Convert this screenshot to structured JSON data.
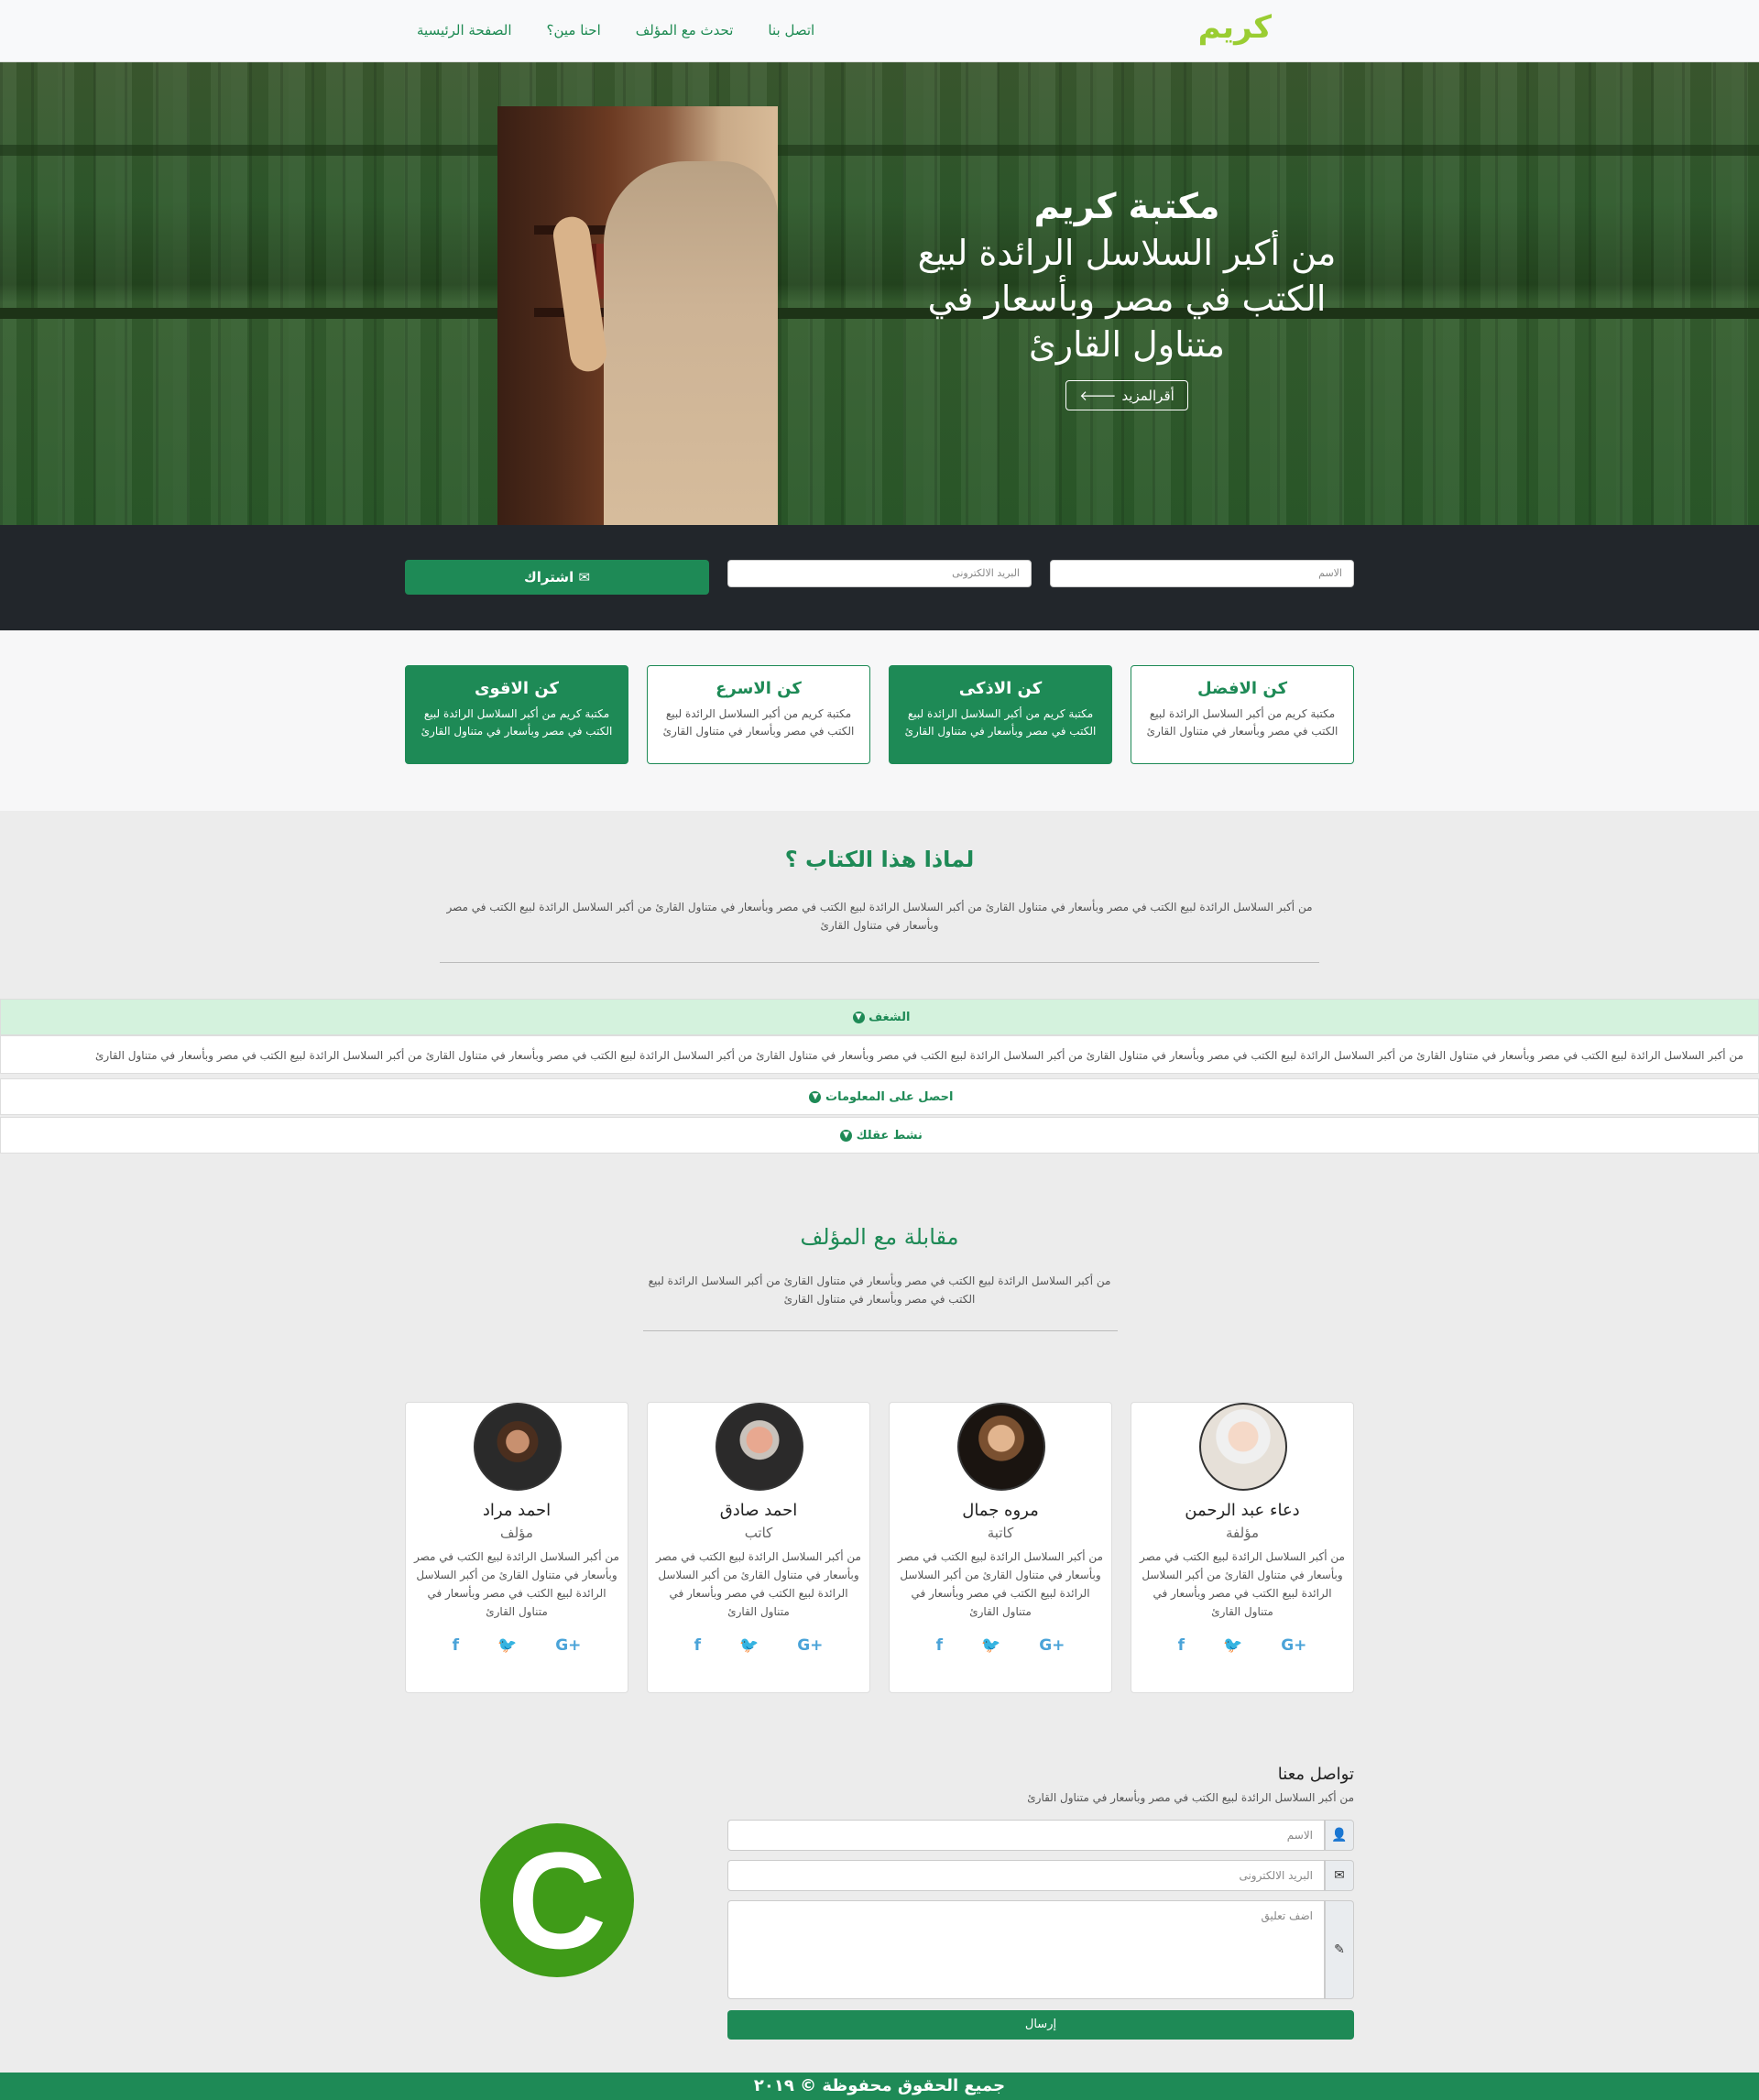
{
  "nav": {
    "brand": "كريم",
    "links": [
      "الصفحة الرئيسية",
      "احنا مين؟",
      "تحدث مع المؤلف",
      "اتصل بنا"
    ]
  },
  "hero": {
    "title": "مكتبة كريم",
    "subtitle": "من أكبر السلاسل الرائدة لبيع الكتب في مصر وبأسعار في متناول القارئ",
    "button_label": "أقرالمزيد",
    "button_icon": "arrow-left-icon"
  },
  "subscribe": {
    "name_placeholder": "الاسم",
    "email_placeholder": "البريد الالكترونى",
    "button_label": "اشتراك",
    "button_icon": "envelope-icon"
  },
  "features": [
    {
      "title": "كن الافضل",
      "text": "مكتبة كريم من أكبر السلاسل الرائدة لبيع الكتب في مصر وبأسعار في متناول القارئ",
      "style": "outline"
    },
    {
      "title": "كن الاذكى",
      "text": "مكتبة كريم من أكبر السلاسل الرائدة لبيع الكتب في مصر وبأسعار في متناول القارئ",
      "style": "filled"
    },
    {
      "title": "كن الاسرع",
      "text": "مكتبة كريم من أكبر السلاسل الرائدة لبيع الكتب في مصر وبأسعار في متناول القارئ",
      "style": "outline"
    },
    {
      "title": "كن الاقوى",
      "text": "مكتبة كريم من أكبر السلاسل الرائدة لبيع الكتب في مصر وبأسعار في متناول القارئ",
      "style": "filled"
    }
  ],
  "why": {
    "title": "لماذا هذا الكتاب ؟",
    "text": "من أكبر السلاسل الرائدة لبيع الكتب في مصر وبأسعار في متناول القارئ من أكبر السلاسل الرائدة لبيع الكتب في مصر وبأسعار في متناول القارئ من أكبر السلاسل الرائدة لبيع الكتب في مصر وبأسعار في متناول القارئ"
  },
  "accordion": {
    "items": [
      "الشغف",
      "احصل على المعلومات",
      "نشط عقلك"
    ],
    "body": "من أكبر السلاسل الرائدة لبيع الكتب في مصر وبأسعار في متناول القارئ من أكبر السلاسل الرائدة لبيع الكتب في مصر وبأسعار في متناول القارئ من أكبر السلاسل الرائدة لبيع الكتب في مصر وبأسعار في متناول القارئ من أكبر السلاسل الرائدة لبيع الكتب في مصر وبأسعار في متناول القارئ من أكبر السلاسل الرائدة لبيع الكتب في مصر وبأسعار في متناول القارئ"
  },
  "interview": {
    "title": "مقابلة مع المؤلف",
    "text": "من أكبر السلاسل الرائدة لبيع الكتب في مصر وبأسعار في متناول القارئ من أكبر السلاسل الرائدة لبيع الكتب في مصر وبأسعار في متناول القارئ"
  },
  "authors": [
    {
      "name": "دعاء عبد الرحمن",
      "role": "مؤلفة",
      "bio": "من أكبر السلاسل الرائدة لبيع الكتب في مصر وبأسعار في متناول القارئ من أكبر السلاسل الرائدة لبيع الكتب في مصر وبأسعار في متناول القارئ"
    },
    {
      "name": "مروه جمال",
      "role": "كاتبة",
      "bio": "من أكبر السلاسل الرائدة لبيع الكتب في مصر وبأسعار في متناول القارئ من أكبر السلاسل الرائدة لبيع الكتب في مصر وبأسعار في متناول القارئ"
    },
    {
      "name": "احمد صادق",
      "role": "كاتب",
      "bio": "من أكبر السلاسل الرائدة لبيع الكتب في مصر وبأسعار في متناول القارئ من أكبر السلاسل الرائدة لبيع الكتب في مصر وبأسعار في متناول القارئ"
    },
    {
      "name": "احمد مراد",
      "role": "مؤلف",
      "bio": "من أكبر السلاسل الرائدة لبيع الكتب في مصر وبأسعار في متناول القارئ من أكبر السلاسل الرائدة لبيع الكتب في مصر وبأسعار في متناول القارئ"
    }
  ],
  "social_icons": [
    "facebook-icon",
    "twitter-icon",
    "google-plus-icon"
  ],
  "contact": {
    "title": "تواصل معنا",
    "subtitle": "من أكبر السلاسل الرائدة لبيع الكتب في مصر وبأسعار في متناول القارئ",
    "logo_letter": "C",
    "name_placeholder": "الاسم",
    "email_placeholder": "البريد الالكترونى",
    "comment_placeholder": "اضف تعليق",
    "send_label": "إرسال"
  },
  "footer": {
    "text": "جميع الحقوق محفوظة © ٢٠١٩"
  },
  "colors": {
    "accent": "#1e8a56",
    "brand": "#9acd32",
    "dark": "#22262b",
    "accordion_active": "#d4f2dd"
  }
}
